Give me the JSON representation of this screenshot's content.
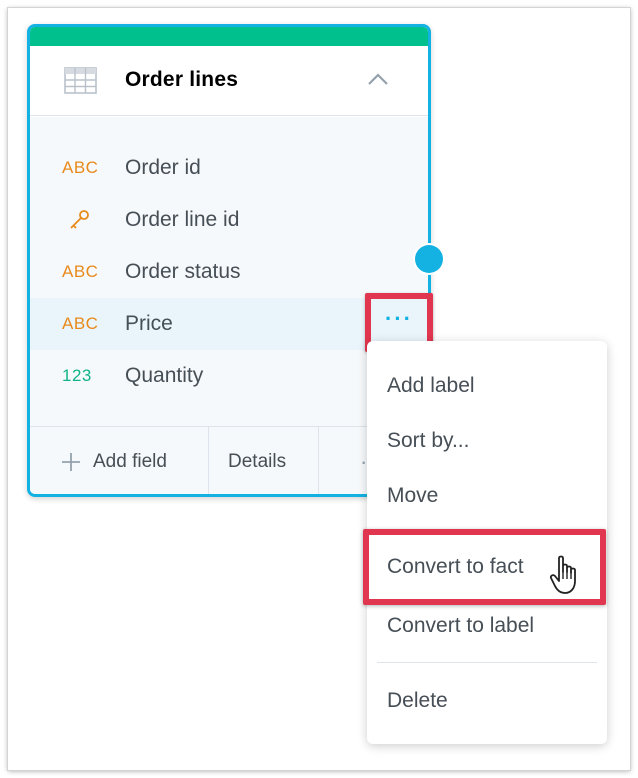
{
  "card": {
    "title": "Order lines",
    "fields": [
      {
        "type": "ABC",
        "type_icon": "text-attribute-icon",
        "name": "Order id"
      },
      {
        "type": "",
        "type_icon": "key-icon",
        "name": "Order line id"
      },
      {
        "type": "ABC",
        "type_icon": "text-attribute-icon",
        "name": "Order status"
      },
      {
        "type": "ABC",
        "type_icon": "text-attribute-icon",
        "name": "Price"
      },
      {
        "type": "123",
        "type_icon": "numeric-fact-icon",
        "name": "Quantity"
      }
    ],
    "footer": {
      "add_field_label": "Add field",
      "details_label": "Details",
      "more_label": "·"
    }
  },
  "more_button": {
    "label": "···"
  },
  "menu": {
    "items": [
      "Add label",
      "Sort by...",
      "Move",
      "Convert to fact",
      "Convert to label",
      "Delete"
    ]
  },
  "colors": {
    "accent_green": "#00c18d",
    "selection_blue": "#14b2e2",
    "highlight_red": "#e1364f",
    "attribute_orange": "#e88a1b",
    "fact_green": "#13b38a"
  }
}
